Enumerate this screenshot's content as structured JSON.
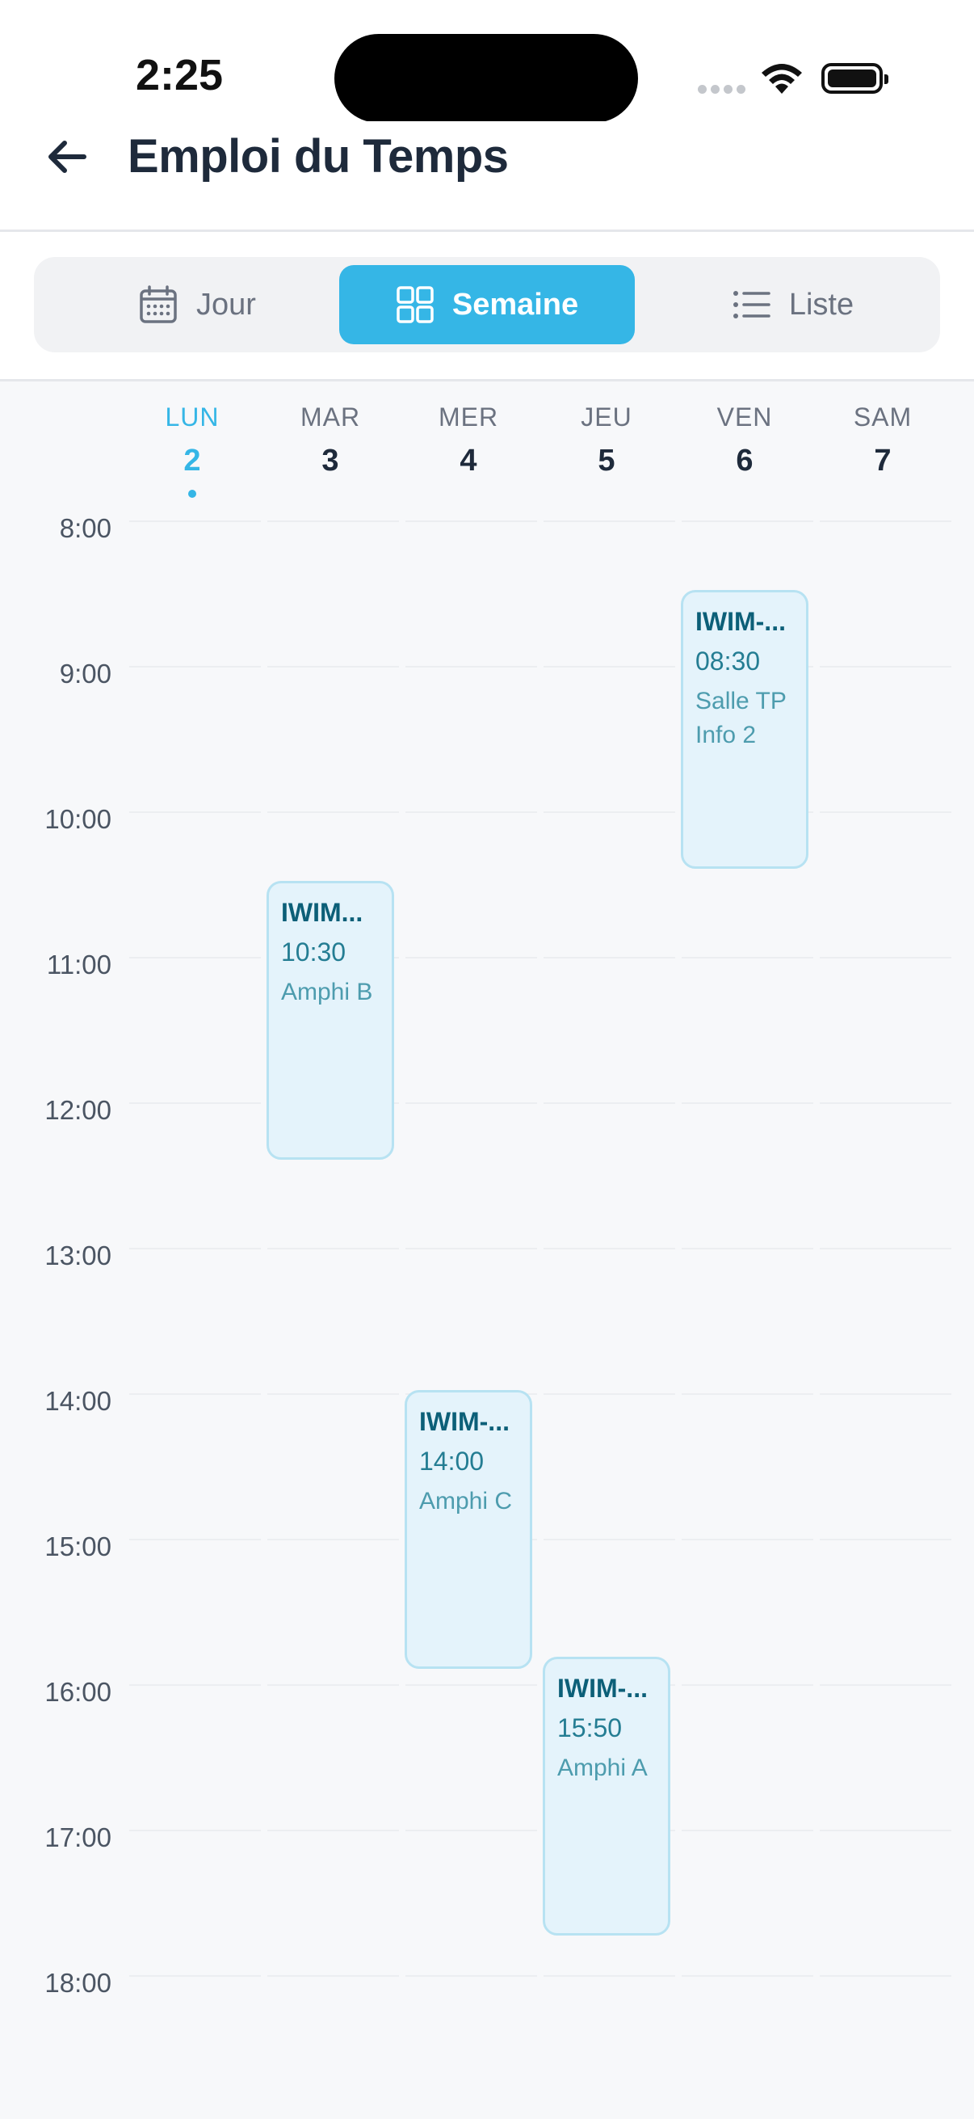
{
  "status_bar": {
    "time": "2:25"
  },
  "header": {
    "title": "Emploi du Temps"
  },
  "view_switcher": {
    "options": [
      {
        "label": "Jour",
        "icon": "calendar-icon"
      },
      {
        "label": "Semaine",
        "icon": "grid-icon",
        "active": true
      },
      {
        "label": "Liste",
        "icon": "list-icon"
      }
    ]
  },
  "days": [
    {
      "name": "LUN",
      "num": "2",
      "today": true
    },
    {
      "name": "MAR",
      "num": "3"
    },
    {
      "name": "MER",
      "num": "4"
    },
    {
      "name": "JEU",
      "num": "5"
    },
    {
      "name": "VEN",
      "num": "6"
    },
    {
      "name": "SAM",
      "num": "7"
    }
  ],
  "hours": [
    "8:00",
    "9:00",
    "10:00",
    "11:00",
    "12:00",
    "13:00",
    "14:00",
    "15:00",
    "16:00",
    "17:00",
    "18:00"
  ],
  "events": [
    {
      "title": "IWIM-...",
      "time": "08:30",
      "room": "Salle TP Info 2",
      "day": "VEN",
      "start": "08:30",
      "end": "10:25"
    },
    {
      "title": "IWIM...",
      "time": "10:30",
      "room": "Amphi B",
      "day": "MAR",
      "start": "10:30",
      "end": "12:25"
    },
    {
      "title": "IWIM-...",
      "time": "14:00",
      "room": "Amphi C",
      "day": "MER",
      "start": "14:00",
      "end": "15:55"
    },
    {
      "title": "IWIM-...",
      "time": "15:50",
      "room": "Amphi A",
      "day": "JEU",
      "start": "15:50",
      "end": "17:45"
    }
  ],
  "colors": {
    "accent": "#35b6e6",
    "event_bg": "#e4f3fb",
    "event_border": "#b7e2f2",
    "event_title": "#0c5f78"
  }
}
